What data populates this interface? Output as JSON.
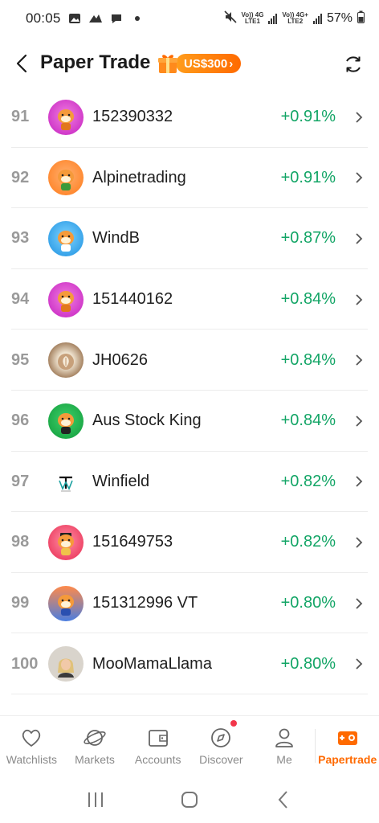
{
  "status_bar": {
    "time": "00:05",
    "net1_top": "Vo))",
    "net1_bottom": "LTE1",
    "net1_gen": "4G",
    "net2_top": "Vo))",
    "net2_bottom": "LTE2",
    "net2_gen": "4G+",
    "battery": "57%"
  },
  "header": {
    "title": "Paper Trade",
    "promo_label": "US$300",
    "promo_chevron": "›"
  },
  "rows": [
    {
      "rank": "91",
      "name": "152390332",
      "change": "+0.91%"
    },
    {
      "rank": "92",
      "name": "Alpinetrading",
      "change": "+0.91%"
    },
    {
      "rank": "93",
      "name": "WindB",
      "change": "+0.87%"
    },
    {
      "rank": "94",
      "name": "151440162",
      "change": "+0.84%"
    },
    {
      "rank": "95",
      "name": "JH0626",
      "change": "+0.84%"
    },
    {
      "rank": "96",
      "name": "Aus Stock King",
      "change": "+0.84%"
    },
    {
      "rank": "97",
      "name": "Winfield",
      "change": "+0.82%"
    },
    {
      "rank": "98",
      "name": "151649753",
      "change": "+0.82%"
    },
    {
      "rank": "99",
      "name": "151312996 VT",
      "change": "+0.80%"
    },
    {
      "rank": "100",
      "name": "MooMamaLlama",
      "change": "+0.80%"
    }
  ],
  "nav": {
    "watchlists": "Watchlists",
    "markets": "Markets",
    "accounts": "Accounts",
    "discover": "Discover",
    "me": "Me",
    "papertrade": "Papertrade"
  },
  "colors": {
    "positive": "#13a566",
    "accent": "#ff6a00",
    "rank_gray": "#9a9a9a"
  }
}
